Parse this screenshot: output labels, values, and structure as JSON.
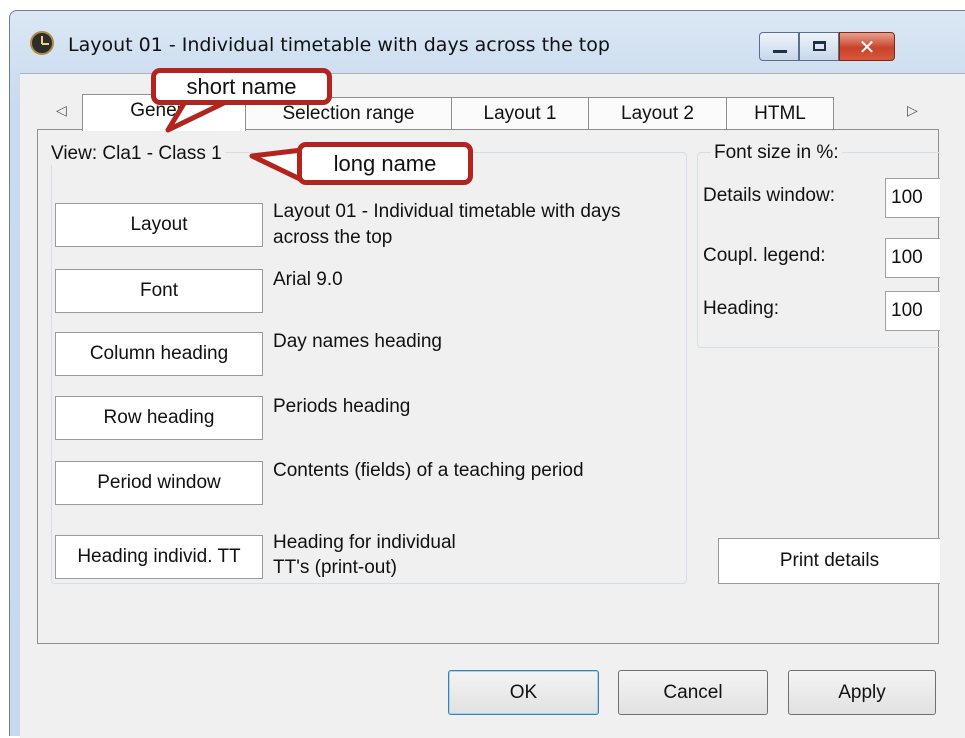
{
  "window": {
    "title": "Layout 01 - Individual timetable with days across the top",
    "close_glyph": "✕"
  },
  "tabs": {
    "left_arrow": "◁",
    "right_arrow": "▷",
    "items": [
      {
        "label": "General",
        "active": true
      },
      {
        "label": "Selection range"
      },
      {
        "label": "Layout 1"
      },
      {
        "label": "Layout 2"
      },
      {
        "label": "HTML"
      }
    ]
  },
  "view_group": {
    "legend": "View: Cla1 - Class 1",
    "rows": [
      {
        "button": "Layout",
        "desc_line1": "Layout 01 - Individual timetable with days",
        "desc_line2": "across the top"
      },
      {
        "button": "Font",
        "desc_line1": "Arial 9.0",
        "desc_line2": ""
      },
      {
        "button": "Column heading",
        "desc_line1": "Day names heading",
        "desc_line2": ""
      },
      {
        "button": "Row heading",
        "desc_line1": "Periods heading",
        "desc_line2": ""
      },
      {
        "button": "Period window",
        "desc_line1": "Contents (fields) of a teaching period",
        "desc_line2": ""
      },
      {
        "button": "Heading individ. TT",
        "desc_line1": "Heading for individual",
        "desc_line2": "TT's (print-out)"
      }
    ]
  },
  "font_size_group": {
    "legend": "Font size in %:",
    "fields": [
      {
        "label": "Details window:",
        "value": "100"
      },
      {
        "label": "Coupl. legend:",
        "value": "100"
      },
      {
        "label": "Heading:",
        "value": "100"
      }
    ]
  },
  "print_details_button": "Print details",
  "footer": {
    "ok": "OK",
    "cancel": "Cancel",
    "apply": "Apply"
  },
  "callouts": {
    "short_name": "short name",
    "long_name": "long name"
  },
  "colors": {
    "callout_border": "#b4241f",
    "close_button": "#c8432b",
    "title_gradient_top": "#dbe7f5"
  }
}
